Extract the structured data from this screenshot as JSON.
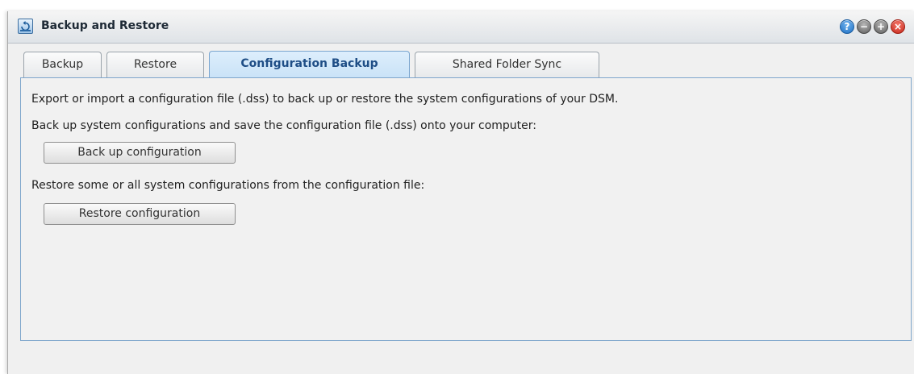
{
  "window": {
    "title": "Backup and Restore",
    "controls": {
      "help": "?",
      "minimize": "−",
      "maximize": "+",
      "close": "×"
    }
  },
  "tabs": [
    {
      "label": "Backup"
    },
    {
      "label": "Restore"
    },
    {
      "label": "Configuration Backup",
      "active": true
    },
    {
      "label": "Shared Folder Sync"
    }
  ],
  "content": {
    "intro": "Export or import a configuration file (.dss) to back up or restore the system configurations of your DSM.",
    "backup_desc": "Back up system configurations and save the configuration file (.dss) onto your computer:",
    "backup_button": "Back up configuration",
    "restore_desc": "Restore some or all system configurations from the configuration file:",
    "restore_button": "Restore configuration"
  },
  "colors": {
    "active_tab_text": "#1f4e86",
    "panel_border": "#7fa6cc"
  }
}
